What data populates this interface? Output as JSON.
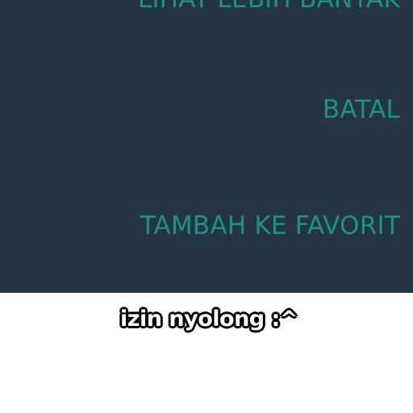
{
  "dialog": {
    "buttons": {
      "more_label": "LIHAT LEBIH BANYAK",
      "cancel_label": "BATAL",
      "favorite_label": "TAMBAH KE FAVORIT"
    },
    "colors": {
      "background": "#253542",
      "accent": "#1a9384"
    }
  },
  "caption": {
    "text": "izin nyolong :^"
  }
}
